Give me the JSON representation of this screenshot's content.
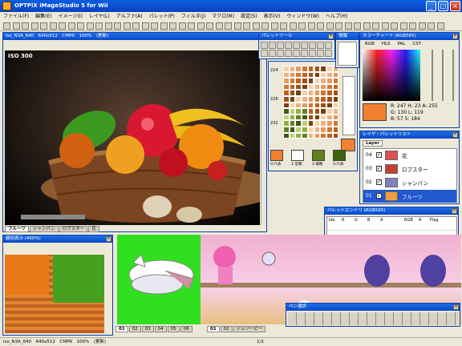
{
  "app": {
    "title": "OPTPiX iMageStudio 5 for Wii"
  },
  "menu": [
    "ファイル(F)",
    "編集(E)",
    "イメージ(I)",
    "レイヤ(L)",
    "アルファ(A)",
    "パレット(P)",
    "フィルタ(J)",
    "マクロ(M)",
    "設定(S)",
    "表示(V)",
    "ウィンドウ(W)",
    "ヘルプ(H)"
  ],
  "image_window": {
    "title": "iso_N3A_640　640x512　CMPR　100%　(更新)",
    "iso_label": "ISO 300",
    "tabs": [
      "フルーツ",
      "シャンパン",
      "ロブスター",
      "花"
    ]
  },
  "palette_tool": {
    "title": "パレットツール",
    "rows": [
      "224",
      "228",
      "232"
    ],
    "swatch_labels": [
      "0:穴表",
      "1:塗類",
      "2:補類",
      "3:穴表"
    ]
  },
  "info": {
    "title": "情報"
  },
  "color_chart": {
    "title": "カラーチャート (RGB565)",
    "tabs": [
      "RGB",
      "HLS",
      "PAL",
      "CST"
    ],
    "values": {
      "R": "247",
      "H": "23",
      "A": "255",
      "G": "130",
      "L": "119",
      "B": "57",
      "S": "184"
    }
  },
  "layer_palette": {
    "title": "レイヤ・パレットリスト",
    "tab": "Layer",
    "items": [
      {
        "num": "04",
        "name": "花"
      },
      {
        "num": "03",
        "name": "ロブスター"
      },
      {
        "num": "02",
        "name": "シャンパン"
      },
      {
        "num": "01",
        "name": "フルーツ"
      }
    ]
  },
  "palette_entry": {
    "title": "パレットエントリ (RGB565)",
    "columns": [
      "Idx",
      "R",
      "G",
      "B",
      "A",
      "RGB",
      "A",
      "Flag"
    ]
  },
  "zoom": {
    "title": "縮倍表示 (400%)"
  },
  "strip_tabs_left": [
    "01",
    "02",
    "03",
    "04",
    "05",
    "06"
  ],
  "strip_tabs_right": [
    "01",
    "02",
    "ジュリーピー"
  ],
  "pen": {
    "title": "ペン選択"
  },
  "status": {
    "text": "iso_N3A_640　640x512　CMPR　100%　(更新)",
    "page": "1/2"
  },
  "colors": {
    "accent": "#0a48c8",
    "selected": "#2058d0"
  }
}
